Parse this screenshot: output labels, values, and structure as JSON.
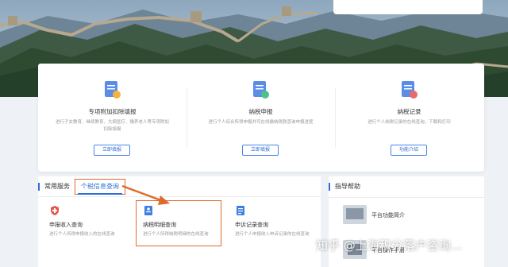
{
  "features": [
    {
      "title": "专项附加扣除填报",
      "desc": "进行子女教育、继续教育、大病医疗、赡养老人等专项附加扣除填报",
      "button": "立即填报",
      "icon": "document-edit-icon"
    },
    {
      "title": "纳税申报",
      "desc": "进行个人综合所得申报并可在线缴纳税款查询申报进度",
      "button": "立即填报",
      "icon": "tax-declare-icon"
    },
    {
      "title": "纳税记录",
      "desc": "进行个人纳税记录的在线查询，下载和打印",
      "button": "功能介绍",
      "icon": "tax-record-icon"
    }
  ],
  "services": {
    "title": "常用服务",
    "active_tab": "个税信息查询",
    "items": [
      {
        "title": "申报收入查询",
        "desc": "进行个人所得申报收入的在线查询",
        "icon": "shield-icon"
      },
      {
        "title": "纳税明细查询",
        "desc": "进行个人所得纳税明细的在线查询",
        "icon": "detail-doc-icon"
      },
      {
        "title": "申诉记录查询",
        "desc": "进行个人申报收入申诉记录的在线查询",
        "icon": "appeal-doc-icon"
      }
    ]
  },
  "guide": {
    "title": "指导帮助",
    "items": [
      {
        "label": "平台功能简介"
      },
      {
        "label": "平台操作手册"
      }
    ]
  },
  "watermark": "知乎 @上海积分落户咨询...",
  "colors": {
    "accent": "#2f6fd6",
    "highlight": "#e06a2c"
  }
}
